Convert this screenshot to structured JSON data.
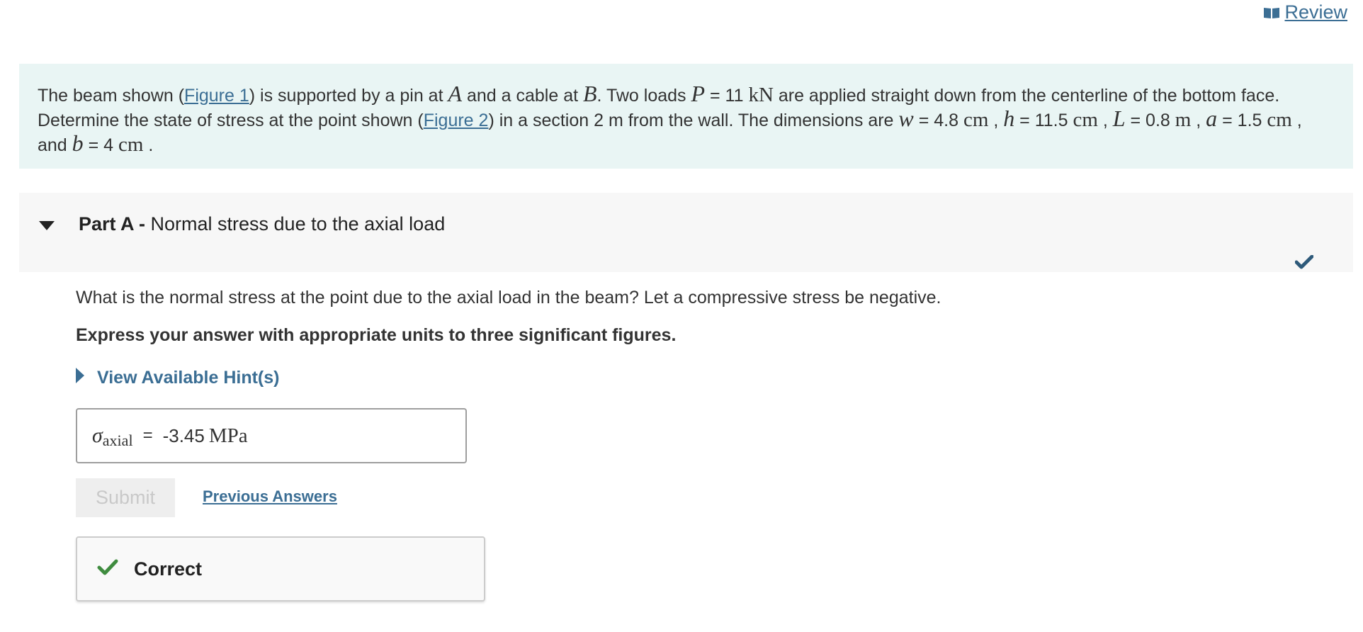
{
  "header": {
    "review_label": " Review",
    "review_icon": "book-icon"
  },
  "problem": {
    "t1": "The beam shown (",
    "fig1": "Figure 1",
    "t2": ") is supported by a pin at ",
    "A": "A",
    "t3": " and a cable at ",
    "B": "B",
    "t4": ". Two loads ",
    "P": "P",
    "t5": " = 11 ",
    "kN": "kN",
    "t6": " are applied straight down from the centerline of the bottom face. Determine the state of stress at the point shown (",
    "fig2": "Figure 2",
    "t7": ") in a section 2 m from the wall. The dimensions are ",
    "w": "w",
    "t8": " = 4.8 ",
    "cm1": "cm",
    "t9": " , ",
    "h": "h",
    "t10": " = 11.5 ",
    "cm2": "cm",
    "t11": " , ",
    "L": "L",
    "t12": " = 0.8 ",
    "m": "m",
    "t13": " , ",
    "a": "a",
    "t14": " = 1.5 ",
    "cm3": "cm",
    "t15": " , and ",
    "b": "b",
    "t16": " = 4 ",
    "cm4": "cm",
    "t17": " ."
  },
  "part": {
    "label": "Part A - ",
    "title": "Normal stress due to the axial load",
    "status": "correct",
    "question": "What is the normal stress at the point due to the axial load in the beam? Let a compressive stress be negative.",
    "instruction": "Express your answer with appropriate units to three significant figures.",
    "hint_label": "View Available Hint(s)",
    "answer": {
      "symbol": "σ",
      "subscript": "axial",
      "equals": "=",
      "value": "-3.45",
      "unit": "MPa"
    },
    "submit_label": "Submit",
    "previous_answers_label": "Previous Answers",
    "feedback_label": "Correct"
  },
  "colors": {
    "link": "#3b6e94",
    "problem_bg": "#e9f5f4",
    "part_header_bg": "#f7f7f7",
    "check_dark": "#2e5a7a",
    "check_green": "#3f8c3f"
  }
}
